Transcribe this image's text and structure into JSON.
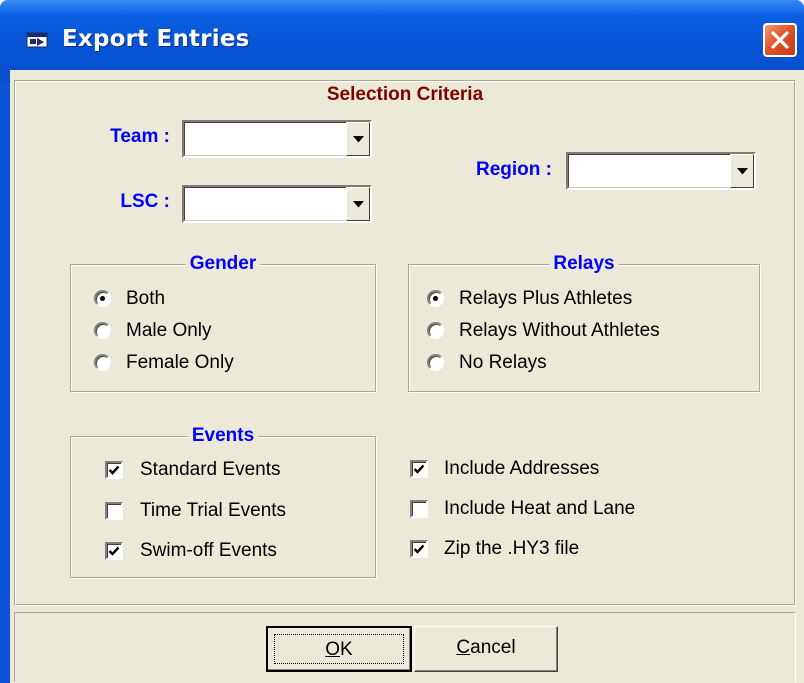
{
  "window": {
    "title": "Export Entries",
    "close_icon": "close-icon",
    "app_icon": "window-app-icon"
  },
  "heading": "Selection Criteria",
  "filters": {
    "team": {
      "label": "Team :",
      "value": ""
    },
    "lsc": {
      "label": "LSC :",
      "value": ""
    },
    "region": {
      "label": "Region :",
      "value": ""
    }
  },
  "gender": {
    "title": "Gender",
    "options": [
      {
        "label": "Both",
        "selected": true
      },
      {
        "label": "Male Only",
        "selected": false
      },
      {
        "label": "Female Only",
        "selected": false
      }
    ]
  },
  "relays": {
    "title": "Relays",
    "options": [
      {
        "label": "Relays Plus Athletes",
        "selected": true
      },
      {
        "label": "Relays Without Athletes",
        "selected": false
      },
      {
        "label": "No Relays",
        "selected": false
      }
    ]
  },
  "events": {
    "title": "Events",
    "options": [
      {
        "label": "Standard Events",
        "checked": true
      },
      {
        "label": "Time Trial Events",
        "checked": false
      },
      {
        "label": "Swim-off Events",
        "checked": true
      }
    ]
  },
  "extras": {
    "options": [
      {
        "label": "Include Addresses",
        "checked": true
      },
      {
        "label": "Include Heat and Lane",
        "checked": false
      },
      {
        "label": "Zip the .HY3 file",
        "checked": true
      }
    ]
  },
  "buttons": {
    "ok": {
      "mnemonic": "O",
      "rest": "K"
    },
    "cancel": {
      "mnemonic": "C",
      "rest": "ancel"
    }
  }
}
